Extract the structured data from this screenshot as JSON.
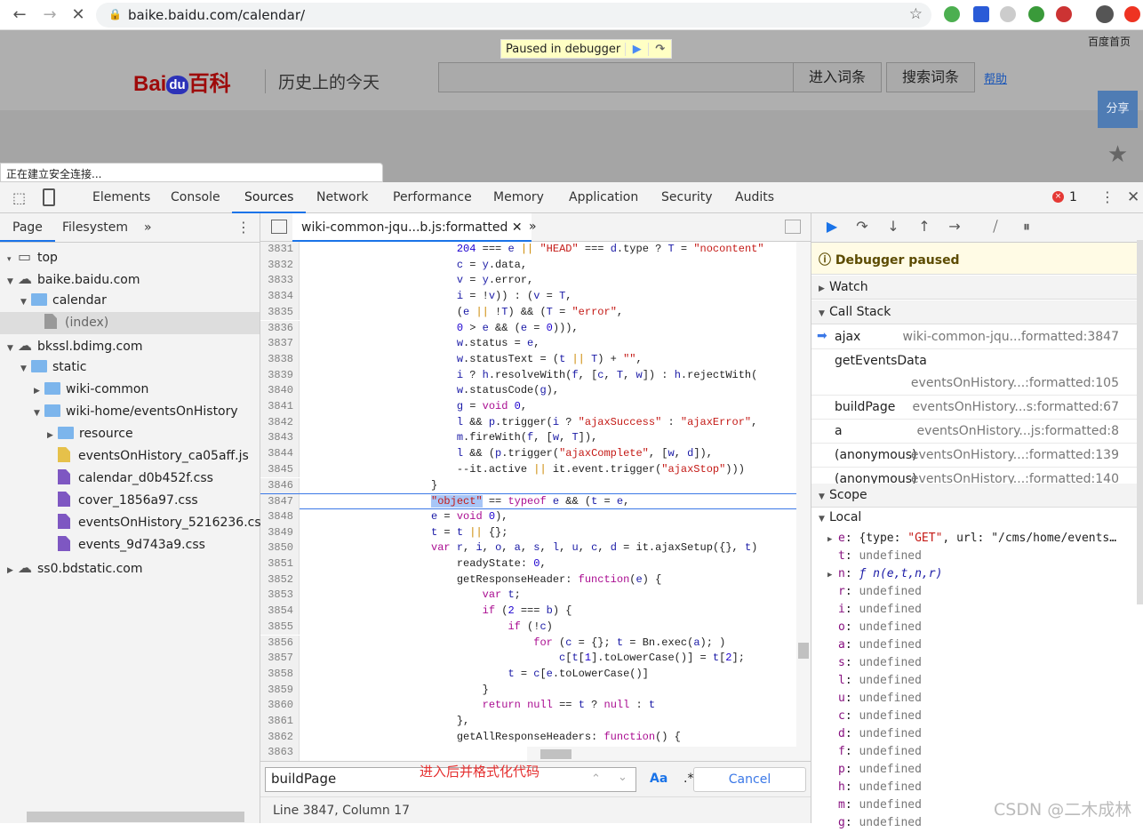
{
  "browser": {
    "url": "baike.baidu.com/calendar/",
    "icons": [
      "back-icon",
      "forward-icon",
      "stop-icon",
      "lock-icon",
      "star-icon",
      "account-icon"
    ]
  },
  "page": {
    "logo": "Baidu百科",
    "logo_bai": "Bai",
    "logo_du": "du",
    "logo_baike": "百科",
    "slogan": "历史上的今天",
    "paused_label": "Paused in debugger",
    "enter_button": "进入词条",
    "search_button": "搜索词条",
    "help": "帮助",
    "home_link": "百度首页",
    "share": "分享",
    "status": "正在建立安全连接..."
  },
  "devtools": {
    "tabs": [
      "Elements",
      "Console",
      "Sources",
      "Network",
      "Performance",
      "Memory",
      "Application",
      "Security",
      "Audits"
    ],
    "active_tab": "Sources",
    "error_count": "1"
  },
  "navigator": {
    "tabs": [
      "Page",
      "Filesystem"
    ],
    "more": "»",
    "tree": [
      {
        "label": "top",
        "icon": "frame"
      },
      {
        "label": "baike.baidu.com",
        "icon": "cloud"
      },
      {
        "label": "calendar",
        "icon": "folder"
      },
      {
        "label": "(index)",
        "icon": "file-doc",
        "selected": true
      },
      {
        "label": "bkssl.bdimg.com",
        "icon": "cloud"
      },
      {
        "label": "static",
        "icon": "folder"
      },
      {
        "label": "wiki-common",
        "icon": "folder"
      },
      {
        "label": "wiki-home/eventsOnHistory",
        "icon": "folder"
      },
      {
        "label": "resource",
        "icon": "folder"
      },
      {
        "label": "eventsOnHistory_ca05aff.js",
        "icon": "file-js"
      },
      {
        "label": "calendar_d0b452f.css",
        "icon": "file-css"
      },
      {
        "label": "cover_1856a97.css",
        "icon": "file-css"
      },
      {
        "label": "eventsOnHistory_5216236.css",
        "icon": "file-css"
      },
      {
        "label": "events_9d743a9.css",
        "icon": "file-css"
      },
      {
        "label": "ss0.bdstatic.com",
        "icon": "cloud"
      }
    ]
  },
  "editor": {
    "file_tab": "wiki-common-jqu...b.js:formatted",
    "current_line": 3847,
    "lines": [
      {
        "n": "3831",
        "code": "                        204 === e || \"HEAD\" === d.type ? T = \"nocontent\""
      },
      {
        "n": "3832",
        "code": "                        c = y.data,"
      },
      {
        "n": "3833",
        "code": "                        v = y.error,"
      },
      {
        "n": "3834",
        "code": "                        i = !v)) : (v = T,"
      },
      {
        "n": "3835",
        "code": "                        (e || !T) && (T = \"error\","
      },
      {
        "n": "3836",
        "code": "                        0 > e && (e = 0))),"
      },
      {
        "n": "3837",
        "code": "                        w.status = e,"
      },
      {
        "n": "3838",
        "code": "                        w.statusText = (t || T) + \"\","
      },
      {
        "n": "3839",
        "code": "                        i ? h.resolveWith(f, [c, T, w]) : h.rejectWith("
      },
      {
        "n": "3840",
        "code": "                        w.statusCode(g),"
      },
      {
        "n": "3841",
        "code": "                        g = void 0,"
      },
      {
        "n": "3842",
        "code": "                        l && p.trigger(i ? \"ajaxSuccess\" : \"ajaxError\","
      },
      {
        "n": "3843",
        "code": "                        m.fireWith(f, [w, T]),"
      },
      {
        "n": "3844",
        "code": "                        l && (p.trigger(\"ajaxComplete\", [w, d]),"
      },
      {
        "n": "3845",
        "code": "                        --it.active || it.event.trigger(\"ajaxStop\")))"
      },
      {
        "n": "3846",
        "code": "                    }"
      },
      {
        "n": "3847",
        "code": "                    \"object\" == typeof e && (t = e,"
      },
      {
        "n": "3848",
        "code": "                    e = void 0),"
      },
      {
        "n": "3849",
        "code": "                    t = t || {};"
      },
      {
        "n": "3850",
        "code": "                    var r, i, o, a, s, l, u, c, d = it.ajaxSetup({}, t)"
      },
      {
        "n": "3851",
        "code": "                        readyState: 0,"
      },
      {
        "n": "3852",
        "code": "                        getResponseHeader: function(e) {"
      },
      {
        "n": "3853",
        "code": "                            var t;"
      },
      {
        "n": "3854",
        "code": "                            if (2 === b) {"
      },
      {
        "n": "3855",
        "code": "                                if (!c)"
      },
      {
        "n": "3856",
        "code": "                                    for (c = {}; t = Bn.exec(a); )"
      },
      {
        "n": "3857",
        "code": "                                        c[t[1].toLowerCase()] = t[2];"
      },
      {
        "n": "3858",
        "code": "                                t = c[e.toLowerCase()]"
      },
      {
        "n": "3859",
        "code": "                            }"
      },
      {
        "n": "3860",
        "code": "                            return null == t ? null : t"
      },
      {
        "n": "3861",
        "code": "                        },"
      },
      {
        "n": "3862",
        "code": "                        getAllResponseHeaders: function() {"
      },
      {
        "n": "3863",
        "code": ""
      }
    ],
    "find": {
      "value": "buildPage",
      "match_case": "Aa",
      "regex": ".*",
      "cancel": "Cancel"
    },
    "annotation": "进入后并格式化代码",
    "status": "Line 3847, Column 17"
  },
  "debugger": {
    "paused": "Debugger paused",
    "watch": "Watch",
    "call_stack": "Call Stack",
    "scope": "Scope",
    "local": "Local",
    "frames": [
      {
        "fn": "ajax",
        "loc": "wiki-common-jqu...formatted:3847",
        "current": true
      },
      {
        "fn": "getEventsData",
        "loc": "eventsOnHistory...:formatted:105"
      },
      {
        "fn": "buildPage",
        "loc": "eventsOnHistory...s:formatted:67"
      },
      {
        "fn": "a",
        "loc": "eventsOnHistory...js:formatted:8"
      },
      {
        "fn": "(anonymous)",
        "loc": "eventsOnHistory...:formatted:139"
      },
      {
        "fn": "(anonymous)",
        "loc": "eventsOnHistory...:formatted:140"
      }
    ],
    "scope_vars": [
      {
        "name": "e",
        "value": "{type: \"GET\", url: \"/cms/home/events…",
        "expandable": true,
        "kind": "obj"
      },
      {
        "name": "t",
        "value": "undefined"
      },
      {
        "name": "n",
        "value": "ƒ n(e,t,n,r)",
        "expandable": true,
        "kind": "fn"
      },
      {
        "name": "r",
        "value": "undefined"
      },
      {
        "name": "i",
        "value": "undefined"
      },
      {
        "name": "o",
        "value": "undefined"
      },
      {
        "name": "a",
        "value": "undefined"
      },
      {
        "name": "s",
        "value": "undefined"
      },
      {
        "name": "l",
        "value": "undefined"
      },
      {
        "name": "u",
        "value": "undefined"
      },
      {
        "name": "c",
        "value": "undefined"
      },
      {
        "name": "d",
        "value": "undefined"
      },
      {
        "name": "f",
        "value": "undefined"
      },
      {
        "name": "p",
        "value": "undefined"
      },
      {
        "name": "h",
        "value": "undefined"
      },
      {
        "name": "m",
        "value": "undefined"
      },
      {
        "name": "g",
        "value": "undefined"
      }
    ]
  },
  "watermark": "CSDN @二木成林",
  "colors": {
    "accent": "#1a73e8",
    "string": "#c41a16",
    "keyword": "#aa0d91",
    "number": "#1c00cf",
    "paused_bg": "#fffbe5"
  }
}
